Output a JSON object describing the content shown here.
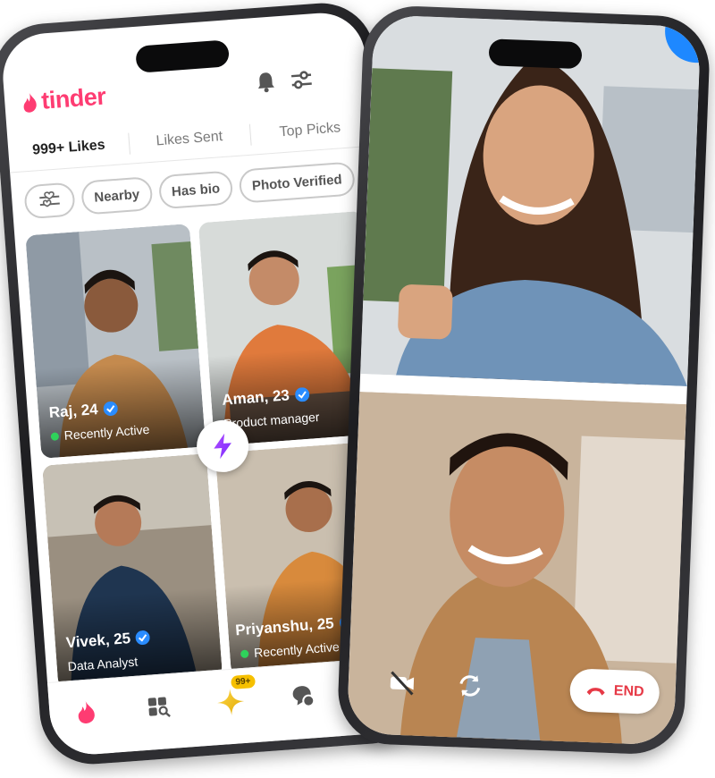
{
  "app": {
    "name": "tinder",
    "brand_color": "#fe3c72"
  },
  "header": {
    "bell_icon": "bell-icon",
    "filter_icon": "sliders-icon"
  },
  "tabs": [
    {
      "label": "999+ Likes",
      "active": true
    },
    {
      "label": "Likes Sent",
      "active": false
    },
    {
      "label": "Top Picks",
      "active": false
    }
  ],
  "filters": [
    "Nearby",
    "Has bio",
    "Photo Verified"
  ],
  "profiles": [
    {
      "name": "Raj, 24",
      "subtitle": "Recently Active",
      "active_dot": true,
      "verified": true,
      "shirt": "#c48a4e",
      "bg": "#b9c0c6"
    },
    {
      "name": "Aman, 23",
      "subtitle": "Product manager",
      "active_dot": false,
      "verified": true,
      "shirt": "#e07a3c",
      "bg": "#d7dbd9"
    },
    {
      "name": "Vivek, 25",
      "subtitle": "Data Analyst",
      "active_dot": false,
      "verified": true,
      "shirt": "#1f3550",
      "bg": "#9a8f80"
    },
    {
      "name": "Priyanshu, 25",
      "subtitle": "Recently Active",
      "active_dot": true,
      "verified": true,
      "shirt": "#d88a3c",
      "bg": "#cabfaf"
    }
  ],
  "bottom_nav": {
    "items": [
      "flame-icon",
      "explore-icon",
      "likes-icon",
      "chat-icon",
      "profile-icon"
    ],
    "likes_badge": "99+"
  },
  "video_call": {
    "end_label": "END",
    "controls": [
      "camera-off-icon",
      "switch-camera-icon",
      "end-call-icon"
    ]
  }
}
